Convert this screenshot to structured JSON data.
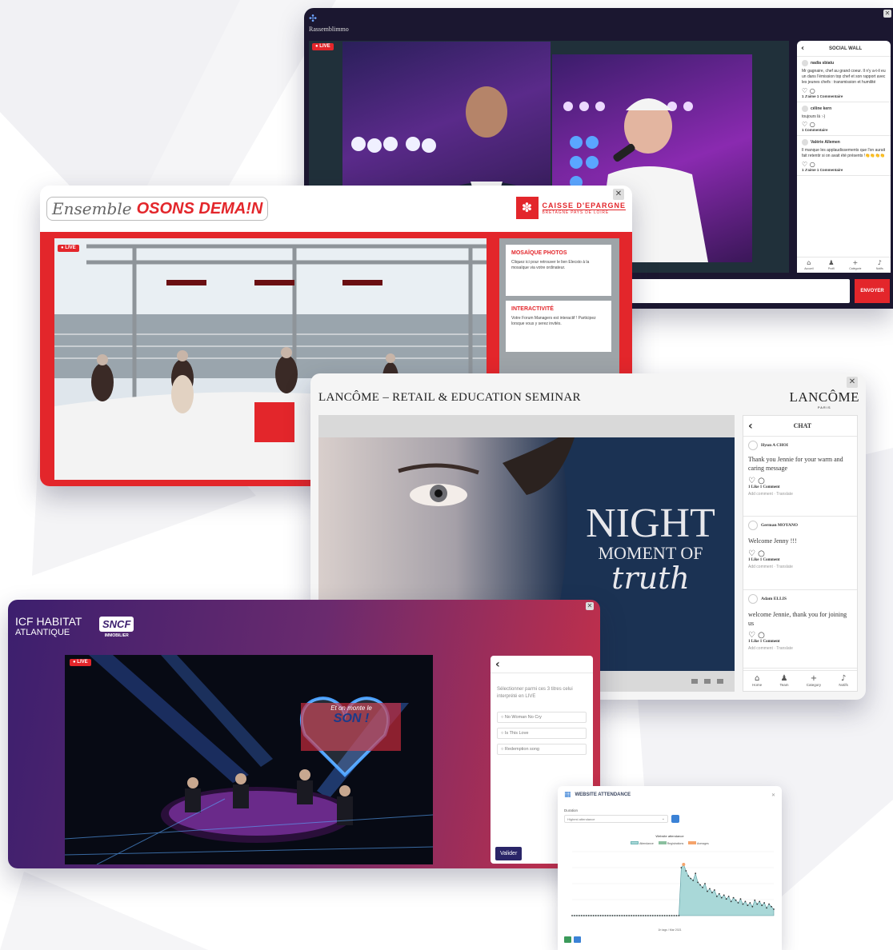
{
  "rassemblimmo": {
    "app_title": "Rassemblimmo",
    "live_badge": "LIVE",
    "wall": {
      "title": "SOCIAL WALL",
      "posts": [
        {
          "author": "nadia sbiatu",
          "text": "Mr gagnaire, chef au grand coeur. Il n'y a-t-il eu un dans l'émission top chef et son rapport avec les jeunes chefs : transmission et humilité",
          "likes": "1 J'aime",
          "comments": "1 Commentaire"
        },
        {
          "author": "céline kern",
          "text": "toujours là :-)",
          "likes": "",
          "comments": "1 Commentaire"
        },
        {
          "author": "Valérie Allemen",
          "text": "Il manque les applaudissements que l'on aurait fait retentir si on avait été présents !👏👏👏👏",
          "likes": "1 J'aime",
          "comments": "1 Commentaire"
        }
      ],
      "nav": [
        "Accueil",
        "Profil",
        "Catégorie",
        "Notifs"
      ]
    },
    "send_button": "ENVOYER"
  },
  "caisse": {
    "event_script": "Ensemble",
    "event_title": "OSONS DEMA!N",
    "brand_name": "CAISSE D'EPARGNE",
    "brand_sub": "BRETAGNE PAYS DE LOIRE",
    "live_badge": "LIVE",
    "panels": [
      {
        "title": "MOSAÏQUE PHOTOS",
        "text": "Cliquez ici pour retrouver le lien Elecsto à la mosaïque via votre ordinateur."
      },
      {
        "title": "INTERACTIVITÉ",
        "text": "Votre Forum Managers est interactif ! Participez lorsque vous y serez invités."
      }
    ]
  },
  "lancome": {
    "event_title": "LANCÔME – RETAIL & EDUCATION SEMINAR",
    "brand_name": "LANCÔME",
    "brand_sub": "PARIS",
    "hero_line1": "NIGHT",
    "hero_line2": "MOMENT OF",
    "hero_line3": "truth",
    "chat": {
      "title": "CHAT",
      "posts": [
        {
          "author": "Hyun A CHOI",
          "text": "Thank you Jennie for your warm and caring message",
          "likes": "1 Like",
          "comments": "1 Comment"
        },
        {
          "author": "German MOYANO",
          "text": "Welcome Jenny !!!",
          "likes": "1 Like",
          "comments": "1 Comment"
        },
        {
          "author": "Adam ELLIS",
          "text": "welcome Jennie, thank you for joining us",
          "likes": "1 Like",
          "comments": "1 Comment"
        }
      ],
      "post_actions": "Add comment · Translate",
      "nav": [
        "Home",
        "Team",
        "Category",
        "Notifs"
      ]
    }
  },
  "icf": {
    "brand_line1": "ICF HABITAT",
    "brand_line2": "ATLANTIQUE",
    "partner_logo": "SNCF",
    "partner_sub": "IMMOBILIER",
    "live_badge": "LIVE",
    "stage_sign_top": "Et on monte le",
    "stage_sign_main": "SON !",
    "poll": {
      "question": "Sélectionner parmi ces 3 titres celui interprété en LIVE",
      "options": [
        "No Woman No Cry",
        "Is This Love",
        "Redemption song"
      ],
      "submit": "Valider"
    }
  },
  "attendance": {
    "title": "WEBSITE ATTENDANCE",
    "filter_label": "Duration",
    "filter_value": "Highest attendance",
    "chart_title": "Website attendance",
    "legend": [
      "Attendance",
      "Registrations",
      "Averages"
    ],
    "xlabel": "1h tags / Mar 2021"
  },
  "chart_data": {
    "type": "area",
    "title": "Website attendance",
    "series": [
      {
        "name": "Attendance",
        "values": [
          0,
          0,
          0,
          0,
          0,
          0,
          0,
          0,
          0,
          0,
          0,
          0,
          0,
          0,
          0,
          0,
          0,
          0,
          0,
          0,
          0,
          0,
          0,
          0,
          0,
          0,
          0,
          0,
          0,
          0,
          0,
          0,
          0,
          0,
          0,
          0,
          0,
          0,
          0,
          0,
          0,
          0,
          0,
          0,
          0,
          0,
          75,
          80,
          70,
          62,
          58,
          55,
          66,
          52,
          48,
          44,
          50,
          38,
          42,
          36,
          40,
          30,
          34,
          28,
          32,
          26,
          30,
          22,
          28,
          24,
          20,
          26,
          18,
          22,
          16,
          20,
          14,
          24,
          18,
          22,
          16,
          20,
          12,
          18,
          14,
          10
        ]
      }
    ],
    "ylim": [
      0,
      100
    ],
    "colors": {
      "Attendance": "#a9d8d8",
      "Registrations": "#8bbf9f",
      "Averages": "#f5a36b"
    }
  },
  "colors": {
    "caisse_red": "#e3262b",
    "icf_purple": "#3c1f6e",
    "icf_red": "#c83048",
    "rass_dark": "#1b1730",
    "accent_blue": "#3b82d6"
  }
}
